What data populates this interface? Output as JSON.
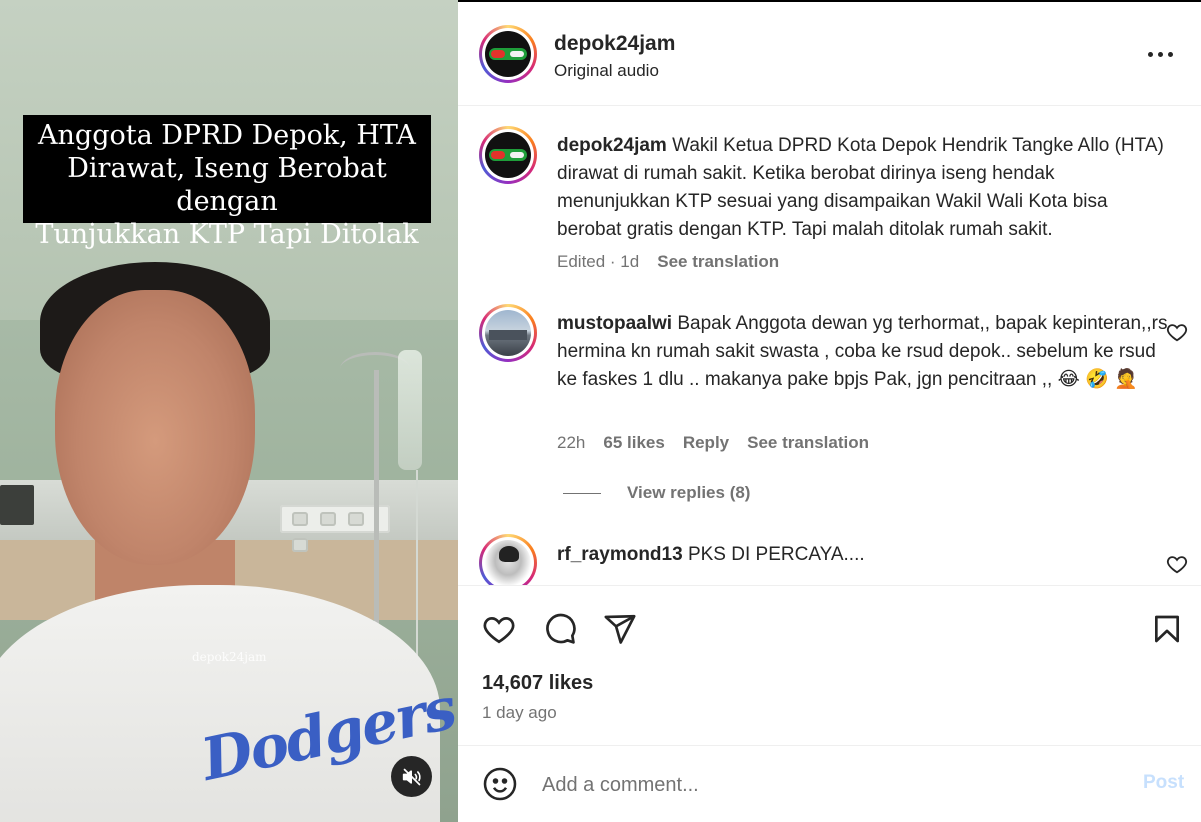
{
  "media": {
    "headline_lines": [
      "Anggota DPRD Depok, HTA",
      "Dirawat, Iseng Berobat dengan",
      "Tunjukkan KTP Tapi Ditolak"
    ],
    "watermark": "depok24jam",
    "shirt_text": "Dodgers",
    "mute_icon": "speaker-muted-icon"
  },
  "header": {
    "username": "depok24jam",
    "audio": "Original audio",
    "more_icon": "more-horizontal-icon"
  },
  "caption": {
    "username": "depok24jam",
    "text": "Wakil Ketua DPRD Kota Depok Hendrik Tangke Allo (HTA) dirawat di rumah sakit. Ketika berobat dirinya iseng hendak menunjukkan KTP sesuai yang disampaikan Wakil Wali Kota bisa berobat gratis dengan KTP. Tapi malah ditolak rumah sakit.",
    "edited": "Edited · 1d",
    "see_translation": "See translation"
  },
  "comments": [
    {
      "username": "mustopaalwi",
      "text": "Bapak Anggota dewan yg terhormat,, bapak kepinteran,,rs hermina kn rumah sakit swasta , coba ke rsud depok.. sebelum ke rsud ke faskes 1 dlu .. makanya pake bpjs Pak, jgn pencitraan ,, 😂 🤣 🤦",
      "time": "22h",
      "likes": "65 likes",
      "reply": "Reply",
      "see_translation": "See translation",
      "view_replies": "View replies (8)"
    },
    {
      "username": "rf_raymond13",
      "text": "PKS DI PERCAYA...."
    }
  ],
  "actions": {
    "like_icon": "heart-icon",
    "comment_icon": "comment-icon",
    "share_icon": "send-icon",
    "save_icon": "bookmark-icon"
  },
  "stats": {
    "likes": "14,607 likes",
    "date": "1 day ago"
  },
  "composer": {
    "placeholder": "Add a comment...",
    "post_label": "Post",
    "emoji_icon": "emoji-icon"
  },
  "colors": {
    "post_disabled": "#c7e0fd",
    "muted_text": "#737373",
    "text": "#262626"
  }
}
